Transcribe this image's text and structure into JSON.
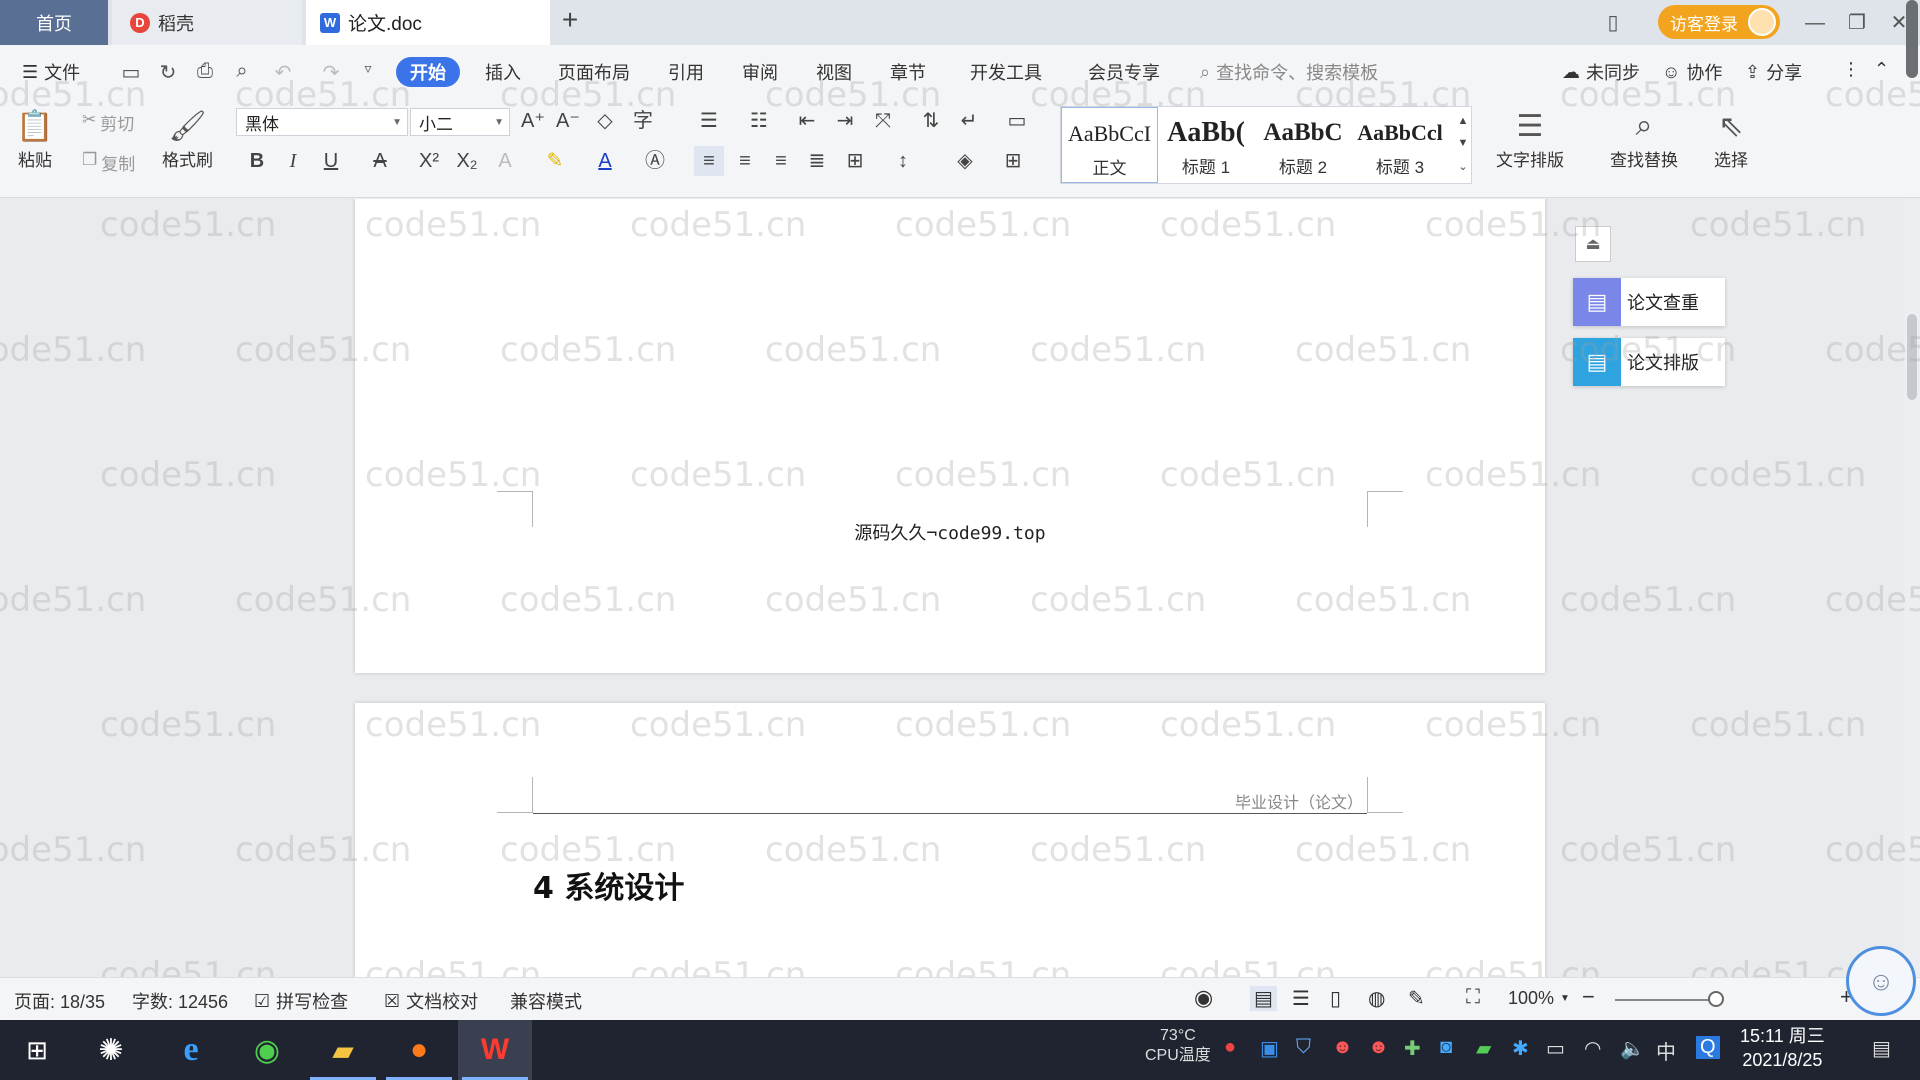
{
  "tabs": {
    "home": "首页",
    "docer": "稻壳",
    "document": "论文.doc",
    "new_tab": "+"
  },
  "window": {
    "login": "访客登录",
    "minimize": "—",
    "restore": "❐",
    "close": "✕"
  },
  "menu": {
    "file": "文件",
    "items": [
      "开始",
      "插入",
      "页面布局",
      "引用",
      "审阅",
      "视图",
      "章节",
      "开发工具",
      "会员专享"
    ],
    "search_placeholder": "查找命令、搜索模板",
    "sync": "未同步",
    "collab": "协作",
    "share": "分享"
  },
  "ribbon": {
    "paste": "粘贴",
    "cut": "剪切",
    "copy": "复制",
    "format_painter": "格式刷",
    "font_name": "黑体",
    "font_size": "小二",
    "styles": [
      {
        "sample": "AaBbCcI",
        "name": "正文"
      },
      {
        "sample": "AaBb(",
        "name": "标题 1"
      },
      {
        "sample": "AaBbC",
        "name": "标题 2"
      },
      {
        "sample": "AaBbCcl",
        "name": "标题 3"
      }
    ],
    "text_layout": "文字排版",
    "find_replace": "查找替换",
    "select": "选择"
  },
  "side_panel": {
    "check": "论文查重",
    "layout": "论文排版"
  },
  "document": {
    "footer_text": "源码久久¬code99.top",
    "header_text": "毕业设计（论文）",
    "heading": "4  系统设计"
  },
  "watermark": "code51.cn",
  "status": {
    "page": "页面: 18/35",
    "words": "字数: 12456",
    "spell": "拼写检查",
    "proof": "文档校对",
    "compat": "兼容模式",
    "zoom": "100%"
  },
  "taskbar": {
    "cpu_temp": "73°C",
    "cpu_label": "CPU温度",
    "ime": "中",
    "time": "15:11 周三",
    "date": "2021/8/25"
  },
  "colors": {
    "accent": "#3a74e8",
    "login": "#f3a41f",
    "taskbar": "#1f2430"
  }
}
